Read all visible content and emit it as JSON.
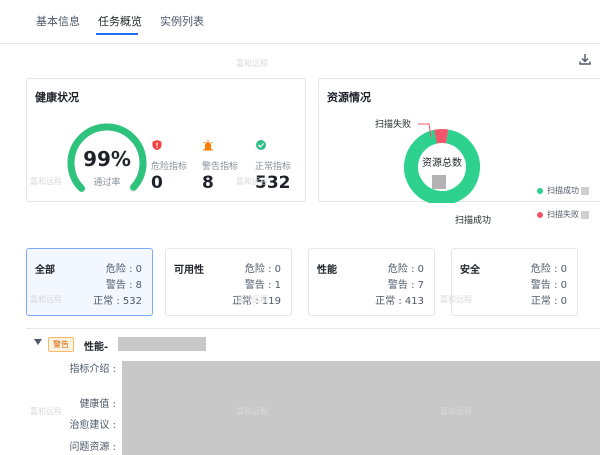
{
  "tabs": [
    {
      "label": "基本信息"
    },
    {
      "label": "任务概览"
    },
    {
      "label": "实例列表"
    }
  ],
  "health": {
    "title": "健康状况",
    "gauge_value": "99%",
    "gauge_fraction": 0.99,
    "gauge_label": "通过率",
    "metrics": [
      {
        "label": "危险指标",
        "value": "0",
        "color": "#f53f3f",
        "icon": "shield-alert-icon"
      },
      {
        "label": "警告指标",
        "value": "8",
        "color": "#ff7d00",
        "icon": "alarm-light-icon"
      },
      {
        "label": "正常指标",
        "value": "532",
        "color": "#2fc088",
        "icon": "check-circle-icon"
      }
    ]
  },
  "resource": {
    "title": "资源情况",
    "center_label": "资源总数",
    "callout_fail": "扫描失败",
    "callout_success": "扫描成功",
    "legend": [
      {
        "label": "扫描成功",
        "color": "#2ed28e"
      },
      {
        "label": "扫描失败",
        "color": "#f2566a"
      }
    ],
    "success_fraction": 0.94,
    "fail_fraction": 0.06
  },
  "categories": [
    {
      "name": "全部",
      "danger_label": "危险",
      "danger": "0",
      "warn_label": "警告",
      "warn": "8",
      "normal_label": "正常",
      "normal": "532",
      "selected": true
    },
    {
      "name": "可用性",
      "danger_label": "危险",
      "danger": "0",
      "warn_label": "警告",
      "warn": "1",
      "normal_label": "正常",
      "normal": "119"
    },
    {
      "name": "性能",
      "danger_label": "危险",
      "danger": "0",
      "warn_label": "警告",
      "warn": "7",
      "normal_label": "正常",
      "normal": "413"
    },
    {
      "name": "安全",
      "danger_label": "危险",
      "danger": "0",
      "warn_label": "警告",
      "warn": "0",
      "normal_label": "正常",
      "normal": "0"
    }
  ],
  "detail": {
    "badge": "警告",
    "title": "性能-",
    "fields": [
      {
        "label": "指标介绍 :"
      },
      {
        "label": "健康值 :"
      },
      {
        "label": "治愈建议 :"
      },
      {
        "label": "问题资源 :"
      }
    ]
  },
  "watermark": "嘉和远程",
  "colors": {
    "accent": "#1e6ff5",
    "gauge": "#2ec37c",
    "success": "#2ed28e",
    "fail": "#f2566a"
  }
}
